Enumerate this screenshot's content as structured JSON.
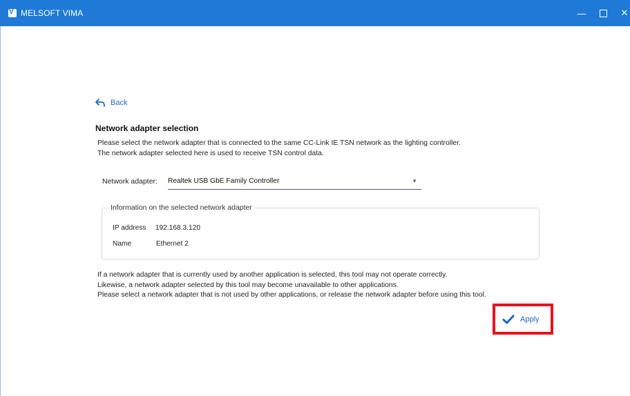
{
  "window": {
    "title": "MELSOFT VIMA",
    "logo_letter": "V",
    "controls": {
      "minimize": "—",
      "close": "✕"
    }
  },
  "nav": {
    "back_label": "Back"
  },
  "section": {
    "title": "Network adapter selection",
    "intro_lines": [
      "Please select the network adapter that is connected to the same CC-Link IE TSN network as the lighting controller.",
      "The network adapter selected here is used to receive TSN control data."
    ]
  },
  "adapter": {
    "label": "Network adapter:",
    "selected": "Realtek USB GbE Family Controller"
  },
  "info": {
    "legend": "Information on the selected network adapter",
    "ip_label": "IP address",
    "ip_value": "192.168.3.120",
    "name_label": "Name",
    "name_value": "Ethernet 2"
  },
  "warning_lines": [
    "If a network adapter that is currently used by another application is selected, this tool may not operate correctly.",
    "Likewise, a network adapter selected by this tool may become unavailable to other applications.",
    "Please select a network adapter that is not used by other applications, or release the network adapter before using this tool."
  ],
  "actions": {
    "apply_label": "Apply"
  },
  "colors": {
    "titlebar": "#1e7ad6",
    "link": "#1f66c1",
    "highlight": "#e6121e"
  }
}
